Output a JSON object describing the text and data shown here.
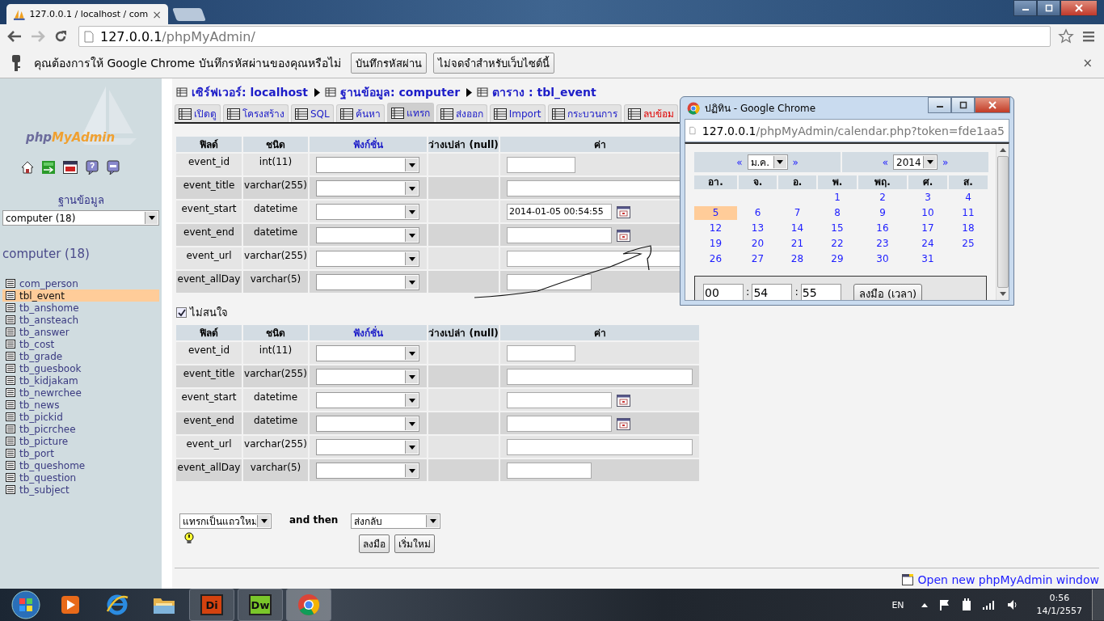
{
  "browser": {
    "tabs": [
      {
        "title": "127.0.0.1 / localhost / com",
        "close": "×",
        "selected": true
      }
    ],
    "address_host": "127.0.0.1",
    "address_path": "/phpMyAdmin/"
  },
  "password_bar": {
    "message": "คุณต้องการให้ Google Chrome บันทึกรหัสผ่านของคุณหรือไม่",
    "buttons": [
      "บันทึกรหัสผ่าน",
      "ไม่จดจำสำหรับเว็บไซต์นี้"
    ],
    "close": "×"
  },
  "sidebar": {
    "logo_prefix": "php",
    "logo_suffix": "MyAdmin",
    "db_label": "ฐานข้อมูล",
    "db_select": "computer (18)",
    "db_heading": "computer (18)",
    "tables": [
      {
        "name": "com_person",
        "selected": false
      },
      {
        "name": "tbl_event",
        "selected": true
      },
      {
        "name": "tb_anshome",
        "selected": false
      },
      {
        "name": "tb_ansteach",
        "selected": false
      },
      {
        "name": "tb_answer",
        "selected": false
      },
      {
        "name": "tb_cost",
        "selected": false
      },
      {
        "name": "tb_grade",
        "selected": false
      },
      {
        "name": "tb_guesbook",
        "selected": false
      },
      {
        "name": "tb_kidjakam",
        "selected": false
      },
      {
        "name": "tb_newrchee",
        "selected": false
      },
      {
        "name": "tb_news",
        "selected": false
      },
      {
        "name": "tb_pickid",
        "selected": false
      },
      {
        "name": "tb_picrchee",
        "selected": false
      },
      {
        "name": "tb_picture",
        "selected": false
      },
      {
        "name": "tb_port",
        "selected": false
      },
      {
        "name": "tb_queshome",
        "selected": false
      },
      {
        "name": "tb_question",
        "selected": false
      },
      {
        "name": "tb_subject",
        "selected": false
      }
    ]
  },
  "breadcrumb": [
    "เซิร์ฟเวอร์: localhost",
    "ฐานข้อมูล: computer",
    "ตาราง : tbl_event"
  ],
  "tabs": [
    {
      "label": "เปิดดู",
      "kind": "normal",
      "selected": false
    },
    {
      "label": "โครงสร้าง",
      "kind": "normal",
      "selected": false
    },
    {
      "label": "SQL",
      "kind": "normal",
      "selected": false
    },
    {
      "label": "ค้นหา",
      "kind": "normal",
      "selected": false
    },
    {
      "label": "แทรก",
      "kind": "normal",
      "selected": true
    },
    {
      "label": "ส่งออก",
      "kind": "normal",
      "selected": false
    },
    {
      "label": "Import",
      "kind": "normal",
      "selected": false
    },
    {
      "label": "กระบวนการ",
      "kind": "normal",
      "selected": false
    },
    {
      "label": "ลบข้อม",
      "kind": "danger",
      "selected": false
    }
  ],
  "insert_forms": [
    {
      "columns": [
        {
          "label": "ฟิลด์",
          "link": false
        },
        {
          "label": "ชนิด",
          "link": false
        },
        {
          "label": "ฟังก์ชั่น",
          "link": true
        },
        {
          "label": "ว่างเปล่า (null)",
          "link": false
        },
        {
          "label": "ค่า",
          "link": false
        }
      ],
      "rows": [
        {
          "field": "event_id",
          "type": "int(11)",
          "kind": "int"
        },
        {
          "field": "event_title",
          "type": "varchar(255)",
          "kind": "text"
        },
        {
          "field": "event_start",
          "type": "datetime",
          "kind": "datetime",
          "value": "2014-01-05 00:54:55"
        },
        {
          "field": "event_end",
          "type": "datetime",
          "kind": "datetime"
        },
        {
          "field": "event_url",
          "type": "varchar(255)",
          "kind": "text"
        },
        {
          "field": "event_allDay",
          "type": "varchar(5)",
          "kind": "short"
        }
      ]
    },
    {
      "ignore": {
        "label": "ไม่สนใจ",
        "checked": true
      },
      "columns": [
        {
          "label": "ฟิลด์",
          "link": false
        },
        {
          "label": "ชนิด",
          "link": false
        },
        {
          "label": "ฟังก์ชั่น",
          "link": true
        },
        {
          "label": "ว่างเปล่า (null)",
          "link": false
        },
        {
          "label": "ค่า",
          "link": false
        }
      ],
      "rows": [
        {
          "field": "event_id",
          "type": "int(11)",
          "kind": "int"
        },
        {
          "field": "event_title",
          "type": "varchar(255)",
          "kind": "text"
        },
        {
          "field": "event_start",
          "type": "datetime",
          "kind": "datetime"
        },
        {
          "field": "event_end",
          "type": "datetime",
          "kind": "datetime"
        },
        {
          "field": "event_url",
          "type": "varchar(255)",
          "kind": "text"
        },
        {
          "field": "event_allDay",
          "type": "varchar(5)",
          "kind": "short"
        }
      ]
    }
  ],
  "footer": {
    "insert_mode": "แทรกเป็นแถวใหม่",
    "and_then": "and then",
    "after": "ส่งกลับ",
    "buttons": [
      "ลงมือ",
      "เริ่มใหม่"
    ],
    "new_window_link": "Open new phpMyAdmin window"
  },
  "calendar_popup": {
    "title": "ปฏิทิน - Google Chrome",
    "address_host": "127.0.0.1",
    "address_path": "/phpMyAdmin/calendar.php?token=fde1aa5",
    "month_nav": {
      "prev": "«",
      "value": "ม.ค.",
      "next": "»"
    },
    "year_nav": {
      "prev": "«",
      "value": "2014",
      "next": "»"
    },
    "weekdays": [
      "อา.",
      "จ.",
      "อ.",
      "พ.",
      "พฤ.",
      "ศ.",
      "ส."
    ],
    "weeks": [
      {
        "days": [
          {
            "label": "1",
            "selected": false
          },
          {
            "label": "2",
            "selected": false
          },
          {
            "label": "3",
            "selected": false
          },
          {
            "label": "4",
            "selected": false
          }
        ]
      },
      {
        "days": [
          {
            "label": "5",
            "selected": true
          },
          {
            "label": "6",
            "selected": false
          },
          {
            "label": "7",
            "selected": false
          },
          {
            "label": "8",
            "selected": false
          },
          {
            "label": "9",
            "selected": false
          },
          {
            "label": "10",
            "selected": false
          },
          {
            "label": "11",
            "selected": false
          }
        ]
      },
      {
        "days": [
          {
            "label": "12",
            "selected": false
          },
          {
            "label": "13",
            "selected": false
          },
          {
            "label": "14",
            "selected": false
          },
          {
            "label": "15",
            "selected": false
          },
          {
            "label": "16",
            "selected": false
          },
          {
            "label": "17",
            "selected": false
          },
          {
            "label": "18",
            "selected": false
          }
        ]
      },
      {
        "days": [
          {
            "label": "19",
            "selected": false
          },
          {
            "label": "20",
            "selected": false
          },
          {
            "label": "21",
            "selected": false
          },
          {
            "label": "22",
            "selected": false
          },
          {
            "label": "23",
            "selected": false
          },
          {
            "label": "24",
            "selected": false
          },
          {
            "label": "25",
            "selected": false
          }
        ]
      },
      {
        "days": [
          {
            "label": "26",
            "selected": false
          },
          {
            "label": "27",
            "selected": false
          },
          {
            "label": "28",
            "selected": false
          },
          {
            "label": "29",
            "selected": false
          },
          {
            "label": "30",
            "selected": false
          },
          {
            "label": "31",
            "selected": false
          }
        ]
      }
    ],
    "time": [
      {
        "value": "00"
      },
      {
        "separator": ":",
        "value": "54"
      },
      {
        "separator": ":",
        "value": "55"
      }
    ],
    "time_button": "ลงมือ (เวลา)"
  },
  "taskbar": {
    "buttons": [
      {
        "kind": "media",
        "selected": false
      },
      {
        "kind": "ie",
        "selected": false
      },
      {
        "kind": "folder",
        "selected": false
      },
      {
        "kind": "app",
        "label": "Di",
        "color": "#d4420f",
        "selected": false
      },
      {
        "kind": "app",
        "label": "Dw",
        "color": "#7ac62a",
        "selected": false
      },
      {
        "kind": "chrome",
        "selected": true
      }
    ],
    "language": "EN",
    "time": "0:56",
    "date": "14/1/2557"
  }
}
